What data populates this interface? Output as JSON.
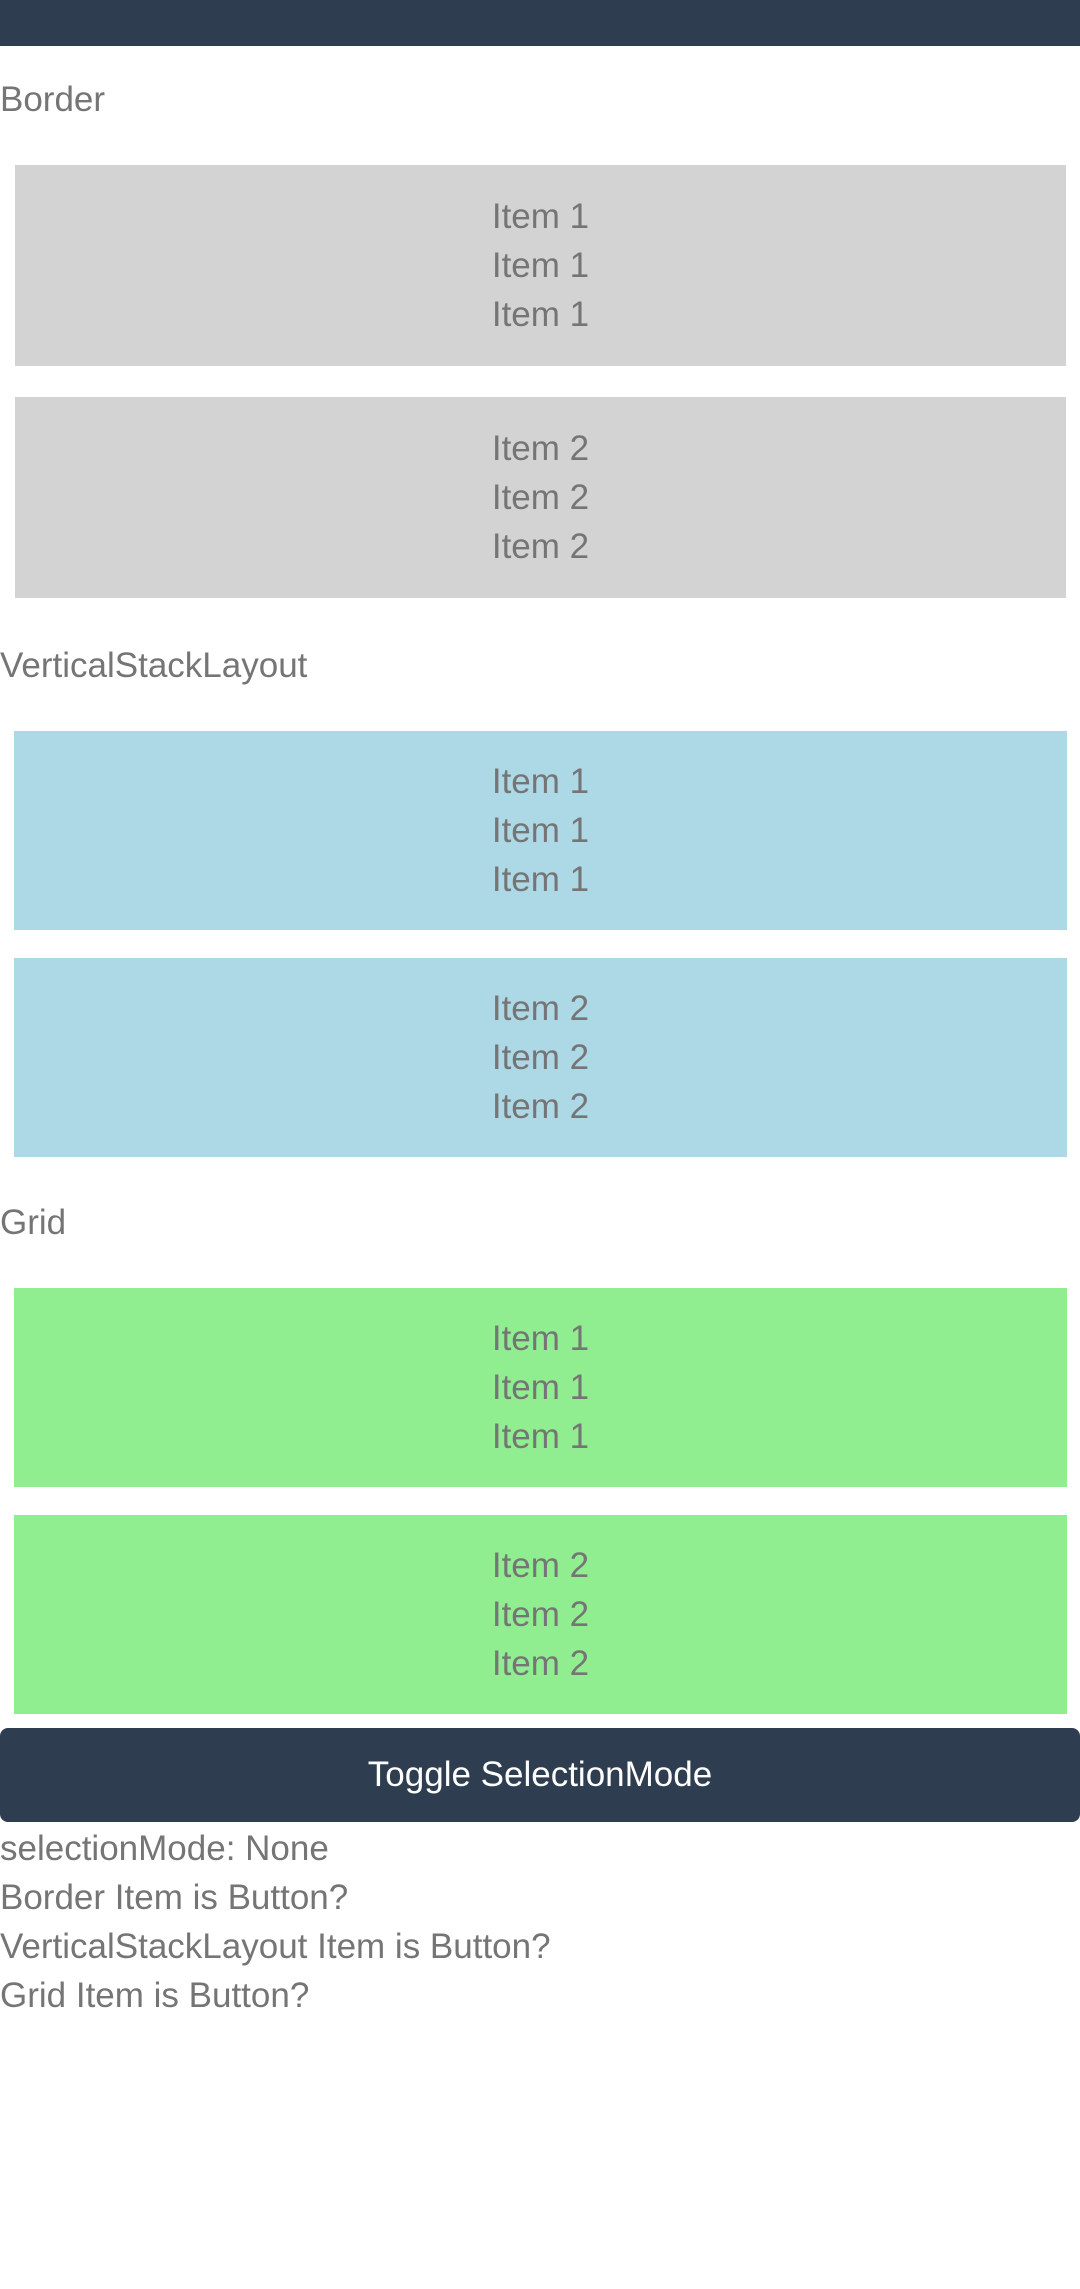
{
  "sections": {
    "border": {
      "label": "Border",
      "items": [
        {
          "lines": [
            "Item 1",
            "Item 1",
            "Item 1"
          ]
        },
        {
          "lines": [
            "Item 2",
            "Item 2",
            "Item 2"
          ]
        }
      ]
    },
    "vertical_stack_layout": {
      "label": "VerticalStackLayout",
      "items": [
        {
          "lines": [
            "Item 1",
            "Item 1",
            "Item 1"
          ]
        },
        {
          "lines": [
            "Item 2",
            "Item 2",
            "Item 2"
          ]
        }
      ]
    },
    "grid": {
      "label": "Grid",
      "items": [
        {
          "lines": [
            "Item 1",
            "Item 1",
            "Item 1"
          ]
        },
        {
          "lines": [
            "Item 2",
            "Item 2",
            "Item 2"
          ]
        }
      ]
    }
  },
  "toggle_button": {
    "label": "Toggle SelectionMode"
  },
  "status": {
    "selection_mode": "selectionMode: None",
    "border_is_button": "Border Item is Button?",
    "vsl_is_button": "VerticalStackLayout Item is Button?",
    "grid_is_button": "Grid Item is Button?"
  },
  "colors": {
    "topbar": "#2e3e50",
    "border_item": "#d3d3d3",
    "vsl_item": "#add8e6",
    "grid_item": "#90ee90",
    "button": "#2e3e50"
  }
}
